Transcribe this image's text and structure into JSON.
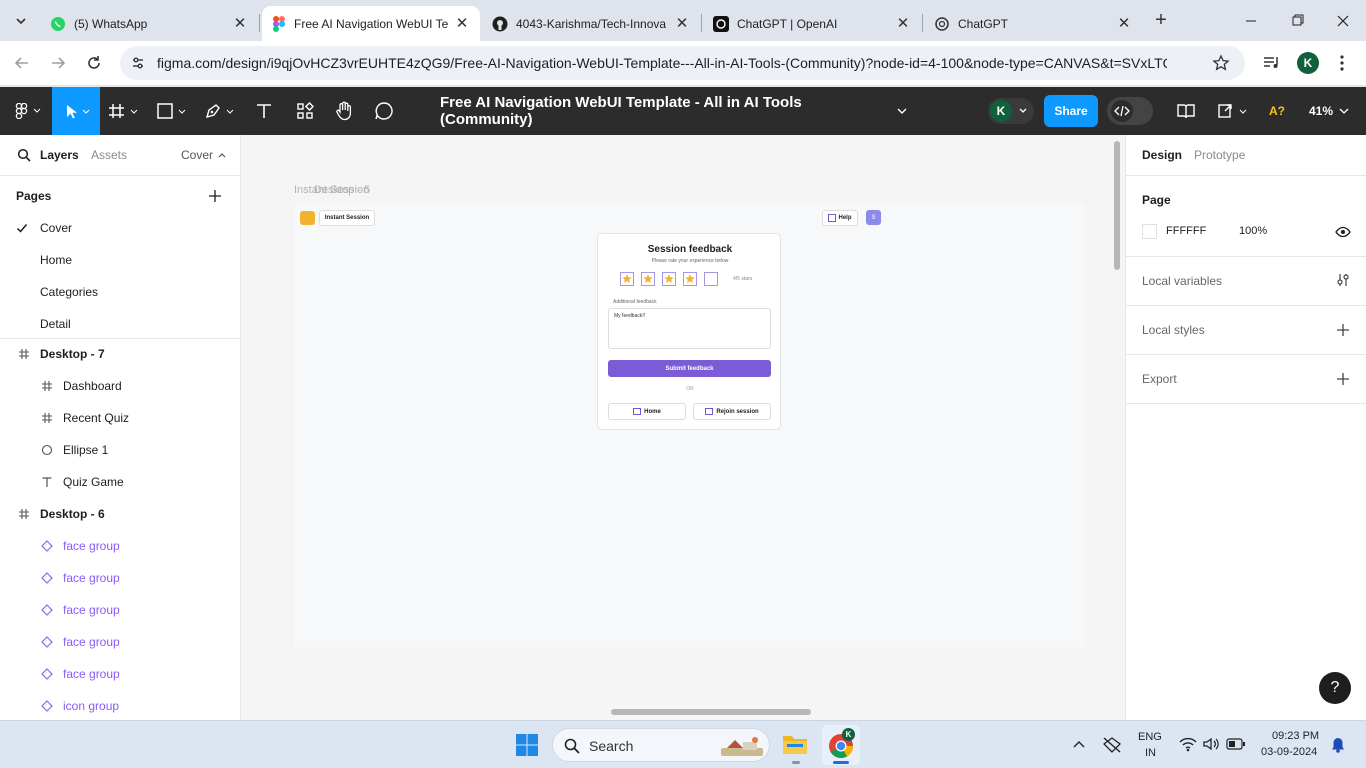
{
  "browser": {
    "tabs": [
      {
        "title": "(5) WhatsApp",
        "icon": "whatsapp-icon",
        "active": false
      },
      {
        "title": "Free AI Navigation WebUI Te",
        "icon": "figma-icon",
        "active": true
      },
      {
        "title": "4043-Karishma/Tech-Innova",
        "icon": "github-icon",
        "active": false
      },
      {
        "title": "ChatGPT | OpenAI",
        "icon": "openai-icon",
        "active": false
      },
      {
        "title": "ChatGPT",
        "icon": "openai-icon",
        "active": false
      }
    ],
    "url": "figma.com/design/i9qjOvHCZ3vrEUHTE4zQG9/Free-AI-Navigation-WebUI-Template---All-in-AI-Tools-(Community)?node-id=4-100&node-type=CANVAS&t=SVxLTQeR...",
    "profile_initial": "K"
  },
  "figma": {
    "file_title": "Free AI Navigation WebUI Template - All in AI Tools (Community)",
    "avatar_initial": "K",
    "share_label": "Share",
    "font_warning": "A?",
    "zoom": "41%"
  },
  "left_panel": {
    "tab_layers": "Layers",
    "tab_assets": "Assets",
    "page_dropdown": "Cover",
    "pages_heading": "Pages",
    "pages": [
      "Cover",
      "Home",
      "Categories",
      "Detail"
    ],
    "current_page": "Cover",
    "layers": [
      {
        "name": "Desktop - 7",
        "icon": "frame-icon",
        "level": 0,
        "component": false
      },
      {
        "name": "Dashboard",
        "icon": "frame-icon",
        "level": 1,
        "component": false
      },
      {
        "name": "Recent Quiz",
        "icon": "frame-icon",
        "level": 1,
        "component": false
      },
      {
        "name": "Ellipse 1",
        "icon": "ellipse-icon",
        "level": 1,
        "component": false
      },
      {
        "name": "Quiz Game",
        "icon": "text-icon",
        "level": 1,
        "component": false
      },
      {
        "name": "Desktop - 6",
        "icon": "frame-icon",
        "level": 0,
        "component": false
      },
      {
        "name": "face group",
        "icon": "instance-icon",
        "level": 1,
        "component": true
      },
      {
        "name": "face group",
        "icon": "instance-icon",
        "level": 1,
        "component": true
      },
      {
        "name": "face group",
        "icon": "instance-icon",
        "level": 1,
        "component": true
      },
      {
        "name": "face group",
        "icon": "instance-icon",
        "level": 1,
        "component": true
      },
      {
        "name": "face group",
        "icon": "instance-icon",
        "level": 1,
        "component": true
      },
      {
        "name": "icon group",
        "icon": "instance-icon",
        "level": 1,
        "component": true
      }
    ]
  },
  "canvas": {
    "frame_label": "Instant Session",
    "frame_label_overlap": "Desktop - 5",
    "design": {
      "session_button": "Instant Session",
      "help_button": "Help",
      "user_initial": "S",
      "card_title": "Session feedback",
      "card_subtitle": "Please rate your experience below",
      "rating": 4,
      "rating_max": 5,
      "rating_text": "4/5 stars",
      "feedback_label": "Additional feedback",
      "feedback_value": "My feedback!!",
      "submit_label": "Submit feedback",
      "or_label": "OR",
      "home_label": "Home",
      "rejoin_label": "Rejoin session"
    }
  },
  "right_panel": {
    "tab_design": "Design",
    "tab_prototype": "Prototype",
    "page_heading": "Page",
    "page_color": "FFFFFF",
    "page_opacity": "100%",
    "local_variables": "Local variables",
    "local_styles": "Local styles",
    "export": "Export",
    "help_glyph": "?"
  },
  "taskbar": {
    "search_placeholder": "Search",
    "lang_top": "ENG",
    "lang_bottom": "IN",
    "time": "09:23 PM",
    "date": "03-09-2024",
    "chrome_badge": "K"
  },
  "colors": {
    "accent_blue": "#0d99ff",
    "purple": "#7b5cd6",
    "star_yellow": "#f4b32f",
    "component_purple": "#8a5cf6"
  }
}
